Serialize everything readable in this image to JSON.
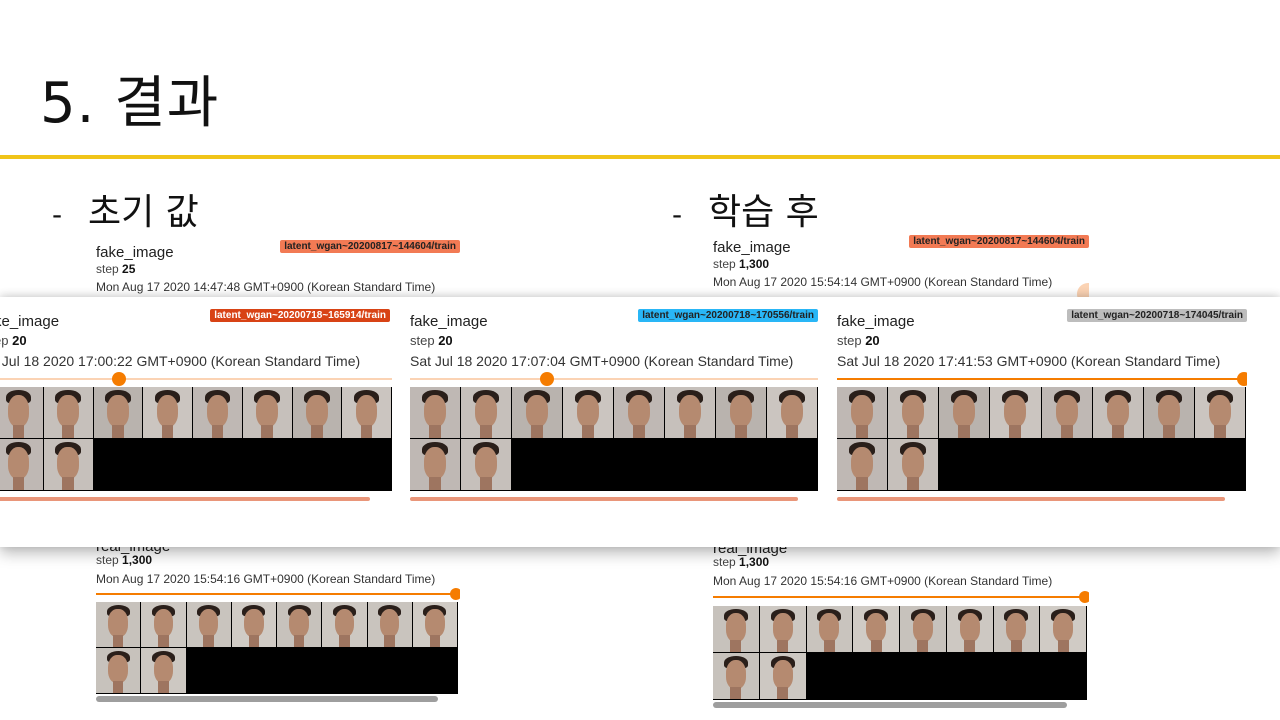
{
  "slide": {
    "title": "5. 결과",
    "bullets": [
      {
        "dash": "-",
        "text": "초기 값"
      },
      {
        "dash": "-",
        "text": "학습 후"
      }
    ],
    "accent_color": "#f0c419"
  },
  "background_cards": [
    {
      "name": "fake_image",
      "step_label": "step",
      "step_value": "25",
      "timestamp": "Mon Aug 17 2020 14:47:48 GMT+0900 (Korean Standard Time)",
      "run": "latent_wgan~20200817~144604/train",
      "run_color": "#f27a54"
    },
    {
      "name": "real_image",
      "step_label": "step",
      "step_value": "1,300",
      "timestamp": "Mon Aug 17 2020 15:54:16 GMT+0900 (Korean Standard Time)",
      "slider_value": 1.0
    },
    {
      "name": "fake_image",
      "step_label": "step",
      "step_value": "1,300",
      "timestamp": "Mon Aug 17 2020 15:54:14 GMT+0900 (Korean Standard Time)",
      "run": "latent_wgan~20200817~144604/train",
      "run_color": "#f27a54"
    },
    {
      "name": "real_image",
      "step_label": "step",
      "step_value": "1,300",
      "timestamp": "Mon Aug 17 2020 15:54:16 GMT+0900 (Korean Standard Time)",
      "slider_value": 1.0
    }
  ],
  "overlay_cards": [
    {
      "name": "ke_image",
      "step_label": "ep",
      "step_value": "20",
      "timestamp": "t Jul 18 2020 17:00:22 GMT+0900 (Korean Standard Time)",
      "run": "latent_wgan~20200718~165914/train",
      "run_color": "#d84315",
      "slider_value": 0.35
    },
    {
      "name": "fake_image",
      "step_label": "step",
      "step_value": "20",
      "timestamp": "Sat Jul 18 2020 17:07:04 GMT+0900 (Korean Standard Time)",
      "run": "latent_wgan~20200718~170556/train",
      "run_color": "#29b6f6",
      "slider_value": 0.33
    },
    {
      "name": "fake_image",
      "step_label": "step",
      "step_value": "20",
      "timestamp": "Sat Jul 18 2020 17:41:53 GMT+0900 (Korean Standard Time)",
      "run": "latent_wgan~20200718~174045/train",
      "run_color": "#bdbdbd",
      "slider_value": 1.0
    }
  ]
}
